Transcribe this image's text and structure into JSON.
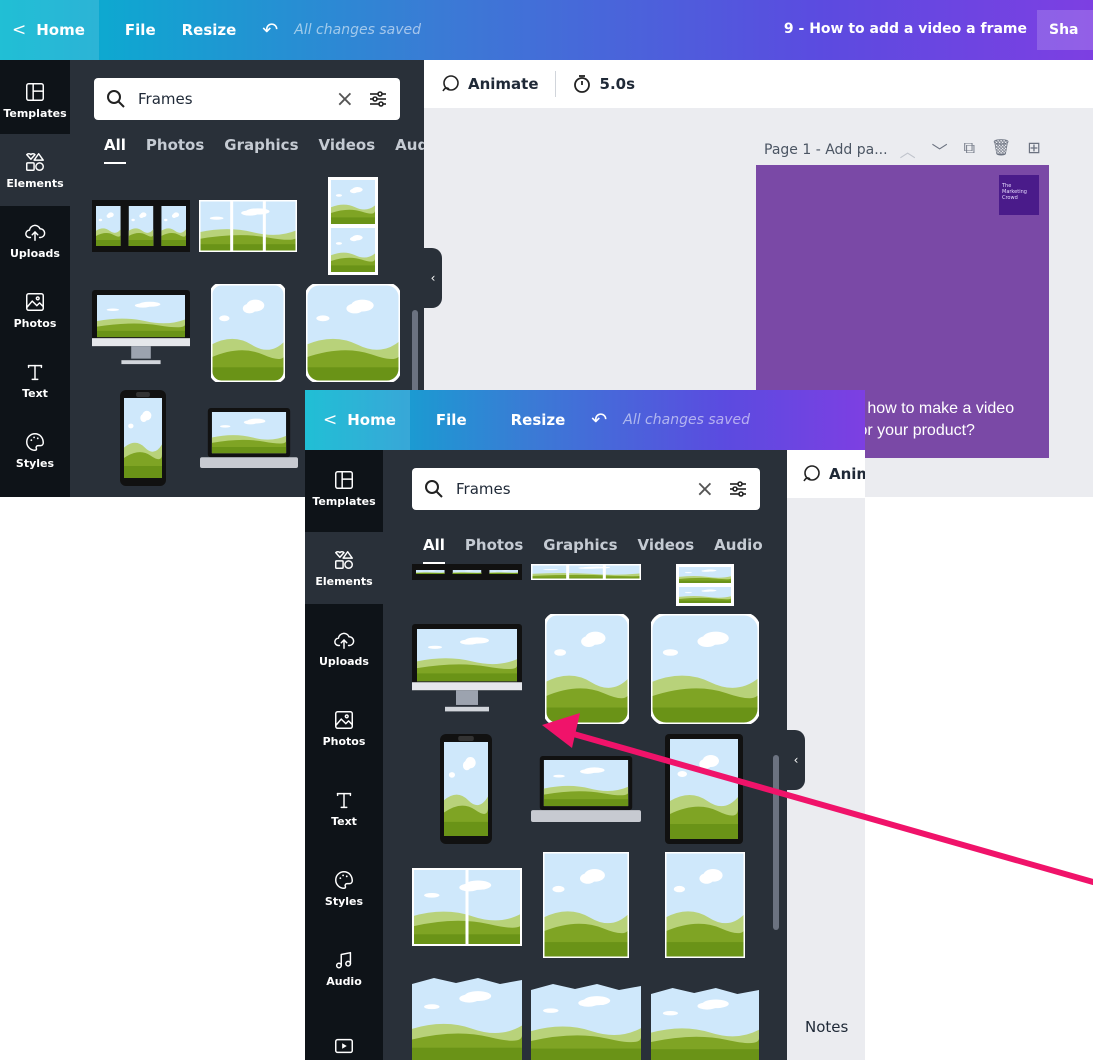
{
  "screen": {
    "topbar": {
      "home_label": "Home",
      "file_label": "File",
      "resize_label": "Resize",
      "saved_text": "All changes saved",
      "doc_title": "9 - How to add a video a frame",
      "share_label": "Sha"
    },
    "rail": {
      "items": [
        {
          "label": "Templates",
          "icon": "templates-icon"
        },
        {
          "label": "Elements",
          "icon": "elements-icon"
        },
        {
          "label": "Uploads",
          "icon": "cloud-upload-icon"
        },
        {
          "label": "Photos",
          "icon": "image-icon"
        },
        {
          "label": "Text",
          "icon": "text-icon"
        },
        {
          "label": "Styles",
          "icon": "palette-icon"
        },
        {
          "label": "Audio",
          "icon": "music-icon"
        },
        {
          "label": "",
          "icon": "video-icon"
        }
      ]
    },
    "search": {
      "value": "Frames",
      "icon": "search-icon"
    },
    "tabs": [
      "All",
      "Photos",
      "Graphics",
      "Videos",
      "Audio"
    ],
    "toolbar": {
      "animate_label": "Animate",
      "duration": "5.0s"
    },
    "page": {
      "label_prefix": "Page 1",
      "label_rest": " - Add pa...",
      "logo_text": "The Marketing Crowd",
      "canvas_line1": "n how to make a video",
      "canvas_line2": "for your product?"
    },
    "notes_label": "Notes"
  },
  "colors": {
    "topbar_start": "#00b6cf",
    "topbar_end": "#7d3fe2",
    "panel_bg": "#293039",
    "rail_bg": "#0e1318",
    "canvas_bg": "#7a49a6",
    "arrow": "#f0136a"
  }
}
